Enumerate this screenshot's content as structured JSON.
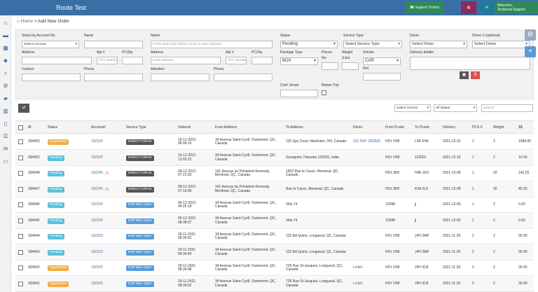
{
  "app": {
    "title": "Route Test"
  },
  "topbar": {
    "support": "Support Tickets",
    "welcome": "Welcome,",
    "user": "Technical Support"
  },
  "breadcrumb": {
    "home": "Home",
    "current": "Add New Order"
  },
  "form": {
    "select_by_account": {
      "label": "Select by Account No",
      "value": "Select Account"
    },
    "name1": {
      "label": "Name",
      "value": ""
    },
    "name2": {
      "label": "Name",
      "placeholder": "Press space bar before name to save address"
    },
    "status": {
      "label": "Status",
      "value": "Pending"
    },
    "service_type": {
      "label": "Service Type",
      "value": "Select Service Type"
    },
    "driver": {
      "label": "Driver",
      "value": "Select Driver"
    },
    "driver2": {
      "label": "Driver 2 (optional)",
      "value": "Select Driver"
    },
    "address1": {
      "label": "Address"
    },
    "apt1": {
      "label": "Apt #",
      "placeholder": "APT Numbe"
    },
    "pczip1": {
      "label": "PC/Zip"
    },
    "address2": {
      "label": "Address",
      "placeholder": "Enter address"
    },
    "apt2": {
      "label": "Apt #",
      "placeholder": "APT Numbe"
    },
    "pczip2": {
      "label": "PC/Zip"
    },
    "package_type": {
      "label": "Package Type",
      "value": "BOX"
    },
    "pieces": {
      "label": "Pieces",
      "sublabel": "No."
    },
    "weight": {
      "label": "Weight",
      "sublabel": "(Lbs)"
    },
    "vehicle": {
      "label": "Vehicle",
      "value": "CAR"
    },
    "ref": {
      "label": "Ref."
    },
    "delivery_details": {
      "label": "Delivery details"
    },
    "contact": {
      "label": "Contact"
    },
    "phone1": {
      "label": "Phone"
    },
    "attention": {
      "label": "Attention"
    },
    "phone2": {
      "label": "Phone"
    },
    "conf_email": {
      "label": "Conf. Email"
    },
    "return_trip": {
      "label": "Return Trip"
    }
  },
  "filters": {
    "select_service": "Select Service",
    "all_status": "All Status",
    "search_placeholder": "Search"
  },
  "table": {
    "headers": [
      "ID",
      "Status",
      "Account#",
      "Service Type",
      "Ordered",
      "From Address",
      "To Address",
      "Driver",
      "From Pcode",
      "To Pcode",
      "Delivery",
      "PCS #",
      "Weight",
      "$$"
    ],
    "rows": [
      {
        "id": "394953",
        "status": "Dispatched",
        "account": "192320",
        "warn": "",
        "service": "DIRECT DRIVE",
        "ordered": "16-12-2021\n06:04:15",
        "from": "34 Avenue Saint-Cyrill, Outremont, QC,\nCanada",
        "to": "120 Spy Court, Markham, ON, Canada",
        "driver": "192 DAY ORDER",
        "from_pcode": "H2V 1H8",
        "to_pcode": "L3R 5H6",
        "delivery": "2021-12-22",
        "pcs": "1",
        "weight": "2",
        "amount": "1084.00"
      },
      {
        "id": "394952",
        "status": "Pending",
        "account": "192320",
        "warn": "",
        "service": "DIRECT DRIVE",
        "ordered": "15-12-2021\n13:03:12",
        "from": "34 Avenue Saint-Cyrill, Outremont, QC,\nCanada",
        "to": "Gurugram, Haryana 122001, India",
        "driver": "",
        "from_pcode": "H2V 1H8",
        "to_pcode": "122001",
        "delivery": "2021-12-15",
        "pcs": "1",
        "weight": "2",
        "amount": "10.00"
      },
      {
        "id": "394948",
        "status": "Pending",
        "account": "192240",
        "warn": "⚠",
        "service": "DIRECT DRIVE",
        "ordered": "08-12-2021\n07:21:20",
        "from": "141 Avenue du Président-Kennedy,\nMontreal, QC, Canada",
        "to": "1852 Rue le Caron, Montreal, QC,\nCanada",
        "driver": "",
        "from_pcode": "H2X 3K8",
        "to_pcode": "H4E 1K3",
        "delivery": "2021-12-08",
        "pcs": "1",
        "weight": "20",
        "amount": "142.25"
      },
      {
        "id": "394947",
        "status": "Pending",
        "account": "192240",
        "warn": "⚠",
        "service": "DIRECT DRIVE",
        "ordered": "08-12-2021\n07:19:05",
        "from": "141 Avenue du Président-Kennedy,\nMontreal, QC, Canada",
        "to": "Rue le Caron, Montreal, QC, Canada",
        "driver": "",
        "from_pcode": "H2X 3K8",
        "to_pcode": "K9A 2L9",
        "delivery": "2021-12-08",
        "pcs": "1",
        "weight": "30",
        "amount": "45.00"
      },
      {
        "id": "394946",
        "status": "Pending",
        "account": "192320",
        "warn": "",
        "service": "EXP 9am-12pm",
        "ordered": "06-12-2021\n04:25:18",
        "from": "34 Avenue Saint-Cyrill, Outremont, QC,\nCanada",
        "to": "Villa 74",
        "driver": "",
        "from_pcode": "12588",
        "to_pcode": "jj",
        "delivery": "2021-12-05",
        "pcs": "1",
        "weight": "2",
        "amount": "0.00"
      },
      {
        "id": "394945",
        "status": "Pending",
        "account": "192320",
        "warn": "",
        "service": "EXP 9am-12pm",
        "ordered": "05-12-2021\n08:38:07",
        "from": "34 Avenue Saint-Cyrill, Outremont, QC,\nCanada",
        "to": "Villa 74",
        "driver": "",
        "from_pcode": "12588",
        "to_pcode": "jj",
        "delivery": "2021-12-05",
        "pcs": "1",
        "weight": "2",
        "amount": "0.00"
      },
      {
        "id": "394944",
        "status": "Pending",
        "account": "192320",
        "warn": "",
        "service": "EXP 9am-12pm",
        "ordered": "29-11-2021\n08:34:52",
        "from": "34 Avenue Saint-Cyrill, Outremont, QC,\nCanada",
        "to": "122 Bd Quinn, Longueuil, QC, Canada",
        "driver": "",
        "from_pcode": "H2V 1H8",
        "to_pcode": "J4H 2M8",
        "delivery": "2021-11-29",
        "pcs": "2",
        "weight": "2",
        "amount": "26.00"
      },
      {
        "id": "394943",
        "status": "Pending",
        "account": "192320",
        "warn": "",
        "service": "EXP 9am-12pm",
        "ordered": "29-11-2021\n08:34:40",
        "from": "34 Avenue Saint-Cyrill, Outremont, QC,\nCanada",
        "to": "122 Bd Quinn, Longueuil, QC, Canada",
        "driver": "",
        "from_pcode": "H2V 1H8",
        "to_pcode": "J4H 2M8",
        "delivery": "2021-11-29",
        "pcs": "2",
        "weight": "2",
        "amount": "26.00"
      },
      {
        "id": "394942",
        "status": "Dispatched",
        "account": "192320",
        "warn": "",
        "service": "EXP 9am-12pm",
        "ordered": "29-11-2021\n08:34:08",
        "from": "34 Avenue Saint-Cyrill, Outremont, QC,\nCanada",
        "to": "729 Rue St-Jacques, Longueuil, QC,\nCanada",
        "driver": "Leilah",
        "from_pcode": "H2V 1H8",
        "to_pcode": "J4H 3C8",
        "delivery": "2021-11-29",
        "pcs": "2",
        "weight": "2",
        "amount": "26.00"
      },
      {
        "id": "394941",
        "status": "Dispatched",
        "account": "192320",
        "warn": "",
        "service": "EXP 9am-12pm",
        "ordered": "29-11-2021\n08:34:02",
        "from": "34 Avenue Saint-Cyrill, Outremont, QC,\nCanada",
        "to": "729 Rue St-Jacques, Longueuil, QC,\nCanada",
        "driver": "Leilah",
        "from_pcode": "H2V 1H8",
        "to_pcode": "J4H 3C8",
        "delivery": "2021-11-29",
        "pcs": "2",
        "weight": "2",
        "amount": "26.00"
      }
    ]
  },
  "colors": {
    "topbar": "#3a6fa5",
    "dispatched": "#f0ad4e",
    "pending": "#5bc0de",
    "direct_drive": "#555555",
    "express": "#5b9bd5",
    "danger": "#d9534f"
  }
}
